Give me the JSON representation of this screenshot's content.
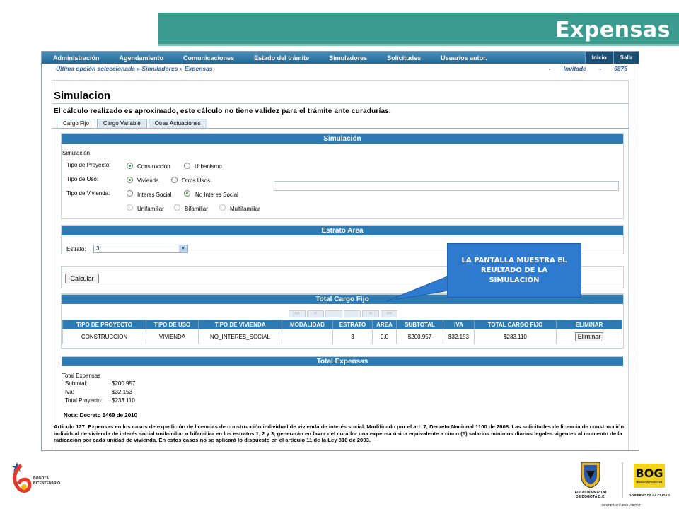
{
  "slide": {
    "title": "Expensas"
  },
  "nav": {
    "items": [
      "Administración",
      "Agendamiento",
      "Comunicaciones",
      "Estado del trámite",
      "Simuladores",
      "Solicitudes",
      "Usuarios autor."
    ],
    "inicio": "Inicio",
    "salir": "Salir"
  },
  "breadcrumb": {
    "path": "Ultima opción seleccionada » Simuladores » Expensas",
    "bullet": "-",
    "user": "Invitado",
    "code": "9876"
  },
  "page": {
    "title": "Simulacion",
    "note": "El cálculo realizado es aproximado, este cálculo no tiene validez para el trámite ante curadurías."
  },
  "tabs": [
    "Cargo Fijo",
    "Cargo Variable",
    "Otras Actuaciones"
  ],
  "simulacion": {
    "header": "Simulación",
    "caption": "Simulación",
    "tipo_proyecto": {
      "label": "Tipo de Proyecto:",
      "options": [
        "Construcción",
        "Urbanismo"
      ],
      "selected": "Construcción"
    },
    "tipo_uso": {
      "label": "Tipo de Uso:",
      "options": [
        "Vivienda",
        "Otros Usos"
      ],
      "selected": "Vivienda"
    },
    "tipo_vivienda": {
      "label": "Tipo de Vivienda:",
      "options": [
        "Interes Social",
        "No Interes Social"
      ],
      "selected": "No Interes Social"
    },
    "modalidad": {
      "options": [
        "Unifamiliar",
        "Bifamiliar",
        "Multifamiliar"
      ]
    }
  },
  "estrato": {
    "header": "Estrato Area",
    "label": "Estrato:",
    "value": "3"
  },
  "calcular_label": "Calcular",
  "total_cargo": {
    "header": "Total Cargo Fijo",
    "pager": [
      "<<",
      "<",
      "",
      "",
      ">",
      ">>"
    ],
    "columns": [
      "TIPO DE PROYECTO",
      "TIPO DE USO",
      "TIPO DE VIVIENDA",
      "MODALIDAD",
      "ESTRATO",
      "AREA",
      "SUBTOTAL",
      "IVA",
      "TOTAL CARGO FIJO",
      "ELIMINAR"
    ],
    "row": {
      "proyecto": "CONSTRUCCION",
      "uso": "VIVIENDA",
      "vivienda": "NO_INTERES_SOCIAL",
      "modalidad": "",
      "estrato": "3",
      "area": "0.0",
      "subtotal": "$200.957",
      "iva": "$32.153",
      "total": "$233.110",
      "eliminar": "Eliminar"
    }
  },
  "total_expensas": {
    "header": "Total Expensas",
    "caption": "Total Expensas",
    "subtotal": {
      "label": "Subtotal:",
      "value": "$200.957"
    },
    "iva": {
      "label": "Iva:",
      "value": "$32.153"
    },
    "total": {
      "label": "Total Proyecto:",
      "value": "$233.110"
    }
  },
  "nota": "Nota: Decreto 1469 de 2010",
  "articulo": "Artículo 127. Expensas en los casos de expedición de licencias de construcción individual de vivienda de interés social. Modificado por el art. 7, Decreto Nacional 1100 de 2008. Las solicitudes de licencia de construcción individual de vivienda de interés social unifamiliar o bifamiliar en los estratos 1, 2 y 3, generarán en favor del curador una expensa única equivalente a cinco (5) salarios mínimos diarios legales vigentes al momento de la radicación por cada unidad de vivienda. En estos casos no se aplicará lo dispuesto en el artículo 11 de la Ley 810 de 2003.",
  "callout": "LA PANTALLA MUESTRA EL REULTADO DE LA SIMULACIÓN",
  "logos": {
    "left": "BOGOTÁ BICENTENARIO",
    "alcaldia": "ALCALDÍA MAYOR DE BOGOTÁ D.C.",
    "bog": "BOG",
    "bog_sub": "BOGOTÁ POSITIVA",
    "gobierno": "GOBIERNO DE LA CIUDAD",
    "secretaria": "SECRETARÍA DE HÁBITAT"
  },
  "colors": {
    "slide_bar": "#3a9b8e",
    "panel_header": "#2e7bb3",
    "callout": "#2e7bd0",
    "bog_yellow": "#f2d21a"
  }
}
